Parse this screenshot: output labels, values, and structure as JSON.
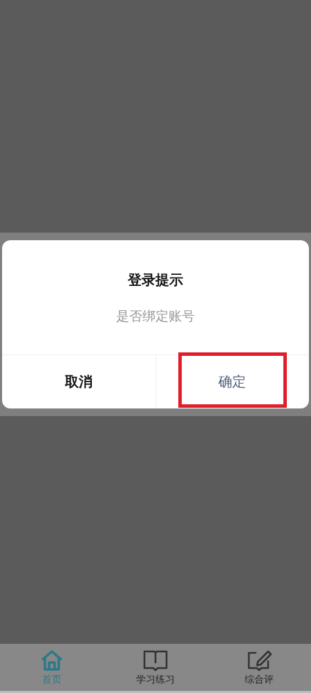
{
  "dialog": {
    "title": "登录提示",
    "message": "是否绑定账号",
    "buttons": [
      {
        "label": "取消",
        "kind": "cancel",
        "highlighted": false
      },
      {
        "label": "确定",
        "kind": "confirm",
        "highlighted": true
      }
    ]
  },
  "tab_bar": {
    "tabs": [
      {
        "label": "首页",
        "kind": "home",
        "selected": true
      },
      {
        "label": "学习练习",
        "kind": "study",
        "selected": false
      },
      {
        "label": "综合评",
        "kind": "review",
        "selected": false
      }
    ]
  }
}
